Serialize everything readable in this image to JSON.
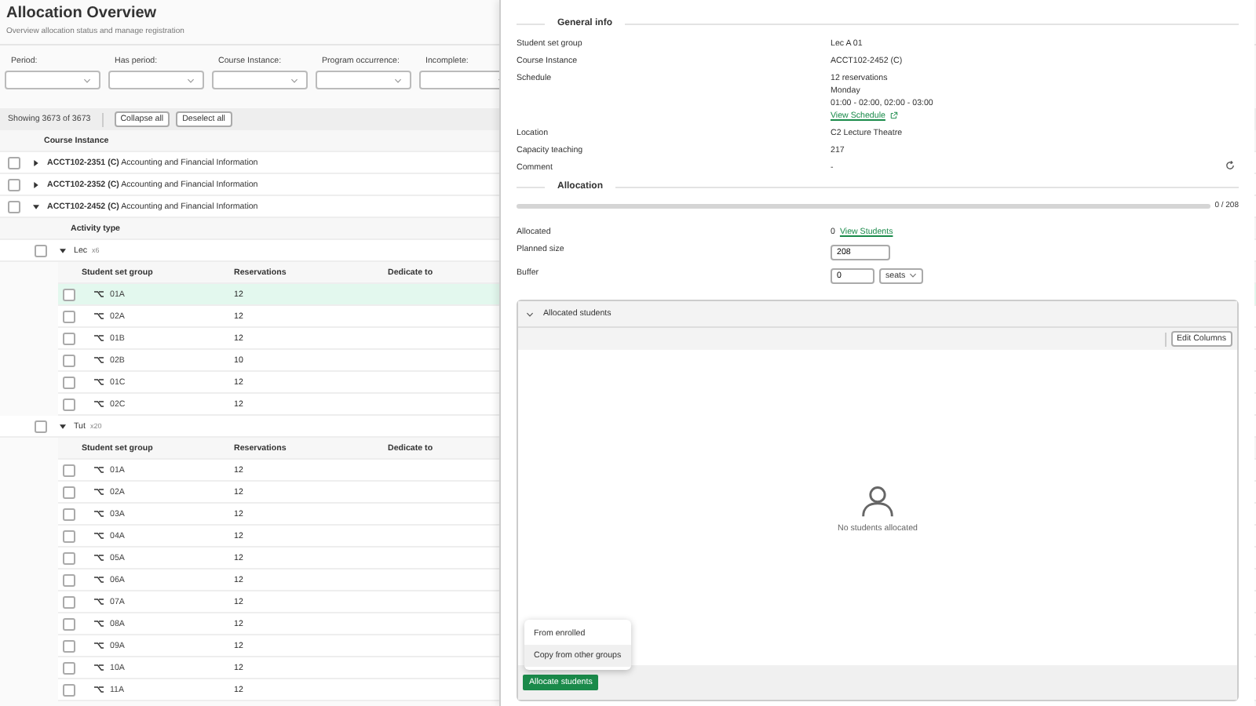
{
  "page": {
    "title": "Allocation Overview",
    "subtitle": "Overview allocation status and manage registration"
  },
  "filters": [
    {
      "label": "Period:"
    },
    {
      "label": "Has period:"
    },
    {
      "label": "Course Instance:"
    },
    {
      "label": "Program occurrence:"
    },
    {
      "label": "Incomplete:"
    }
  ],
  "toolbar": {
    "count": "Showing 3673 of 3673",
    "buttons": [
      "Collapse all",
      "Deselect all"
    ]
  },
  "table": {
    "column": "Course Instance",
    "child_column": "Activity type",
    "courses": [
      {
        "code": "ACCT102-2351 (C)",
        "name": "Accounting and Financial Information",
        "checked": false,
        "expanded": false
      },
      {
        "code": "ACCT102-2352 (C)",
        "name": "Accounting and Financial Information",
        "checked": false,
        "expanded": false
      },
      {
        "code": "ACCT102-2452 (C)",
        "name": "Accounting and Financial Information",
        "checked": false,
        "expanded": true,
        "children": [
          {
            "name": "Lec",
            "count": "x6",
            "checked": false,
            "expanded": true,
            "columns": [
              "Student set group",
              "Reservations",
              "Dedicate to"
            ],
            "children": [
              {
                "name": "01A",
                "reservations": "12",
                "checked": false,
                "selected": true
              },
              {
                "name": "02A",
                "reservations": "12",
                "checked": false,
                "selected": false
              },
              {
                "name": "01B",
                "reservations": "12",
                "checked": false,
                "selected": false
              },
              {
                "name": "02B",
                "reservations": "10",
                "checked": false,
                "selected": false
              },
              {
                "name": "01C",
                "reservations": "12",
                "checked": false,
                "selected": false
              },
              {
                "name": "02C",
                "reservations": "12",
                "checked": false,
                "selected": false
              }
            ]
          },
          {
            "name": "Tut",
            "count": "x20",
            "checked": false,
            "expanded": true,
            "columns": [
              "Student set group",
              "Reservations",
              "Dedicate to"
            ],
            "children": [
              {
                "name": "01A",
                "reservations": "12",
                "checked": false,
                "selected": false
              },
              {
                "name": "02A",
                "reservations": "12",
                "checked": false,
                "selected": false
              },
              {
                "name": "03A",
                "reservations": "12",
                "checked": false,
                "selected": false
              },
              {
                "name": "04A",
                "reservations": "12",
                "checked": false,
                "selected": false
              },
              {
                "name": "05A",
                "reservations": "12",
                "checked": false,
                "selected": false
              },
              {
                "name": "06A",
                "reservations": "12",
                "checked": false,
                "selected": false
              },
              {
                "name": "07A",
                "reservations": "12",
                "checked": false,
                "selected": false
              },
              {
                "name": "08A",
                "reservations": "12",
                "checked": false,
                "selected": false
              },
              {
                "name": "09A",
                "reservations": "12",
                "checked": false,
                "selected": false
              },
              {
                "name": "10A",
                "reservations": "12",
                "checked": false,
                "selected": false
              },
              {
                "name": "11A",
                "reservations": "12",
                "checked": false,
                "selected": false
              }
            ]
          }
        ]
      }
    ]
  },
  "drawer": {
    "general_title": "General info",
    "info": [
      {
        "label": "Student set group",
        "values": [
          "Lec A 01"
        ]
      },
      {
        "label": "Course Instance",
        "values": [
          "ACCT102-2452 (C)"
        ]
      },
      {
        "label": "Schedule",
        "values": [
          "12 reservations",
          "Monday",
          "01:00 - 02:00, 02:00 - 03:00"
        ],
        "link": "View Schedule"
      },
      {
        "label": "Location",
        "values": [
          "C2 Lecture Theatre"
        ]
      },
      {
        "label": "Capacity teaching",
        "values": [
          "217"
        ]
      },
      {
        "label": "Comment",
        "values": [
          "-"
        ]
      }
    ],
    "allocation_title": "Allocation",
    "progress": {
      "level": 0,
      "reading": "0 / 208"
    },
    "allocated": {
      "label": "Allocated",
      "value": "0",
      "link": "View Students"
    },
    "planned_size": {
      "label": "Planned size",
      "value": "208"
    },
    "buffer": {
      "label": "Buffer",
      "value": "0",
      "unit": "seats"
    },
    "panel": {
      "title": "Allocated students",
      "expanded": true,
      "edit_button": "Edit Columns",
      "empty_text": "No students allocated",
      "action_button": "Allocate students",
      "menu": [
        {
          "label": "From enrolled",
          "selected": false
        },
        {
          "label": "Copy from other groups",
          "selected": true
        }
      ]
    }
  }
}
